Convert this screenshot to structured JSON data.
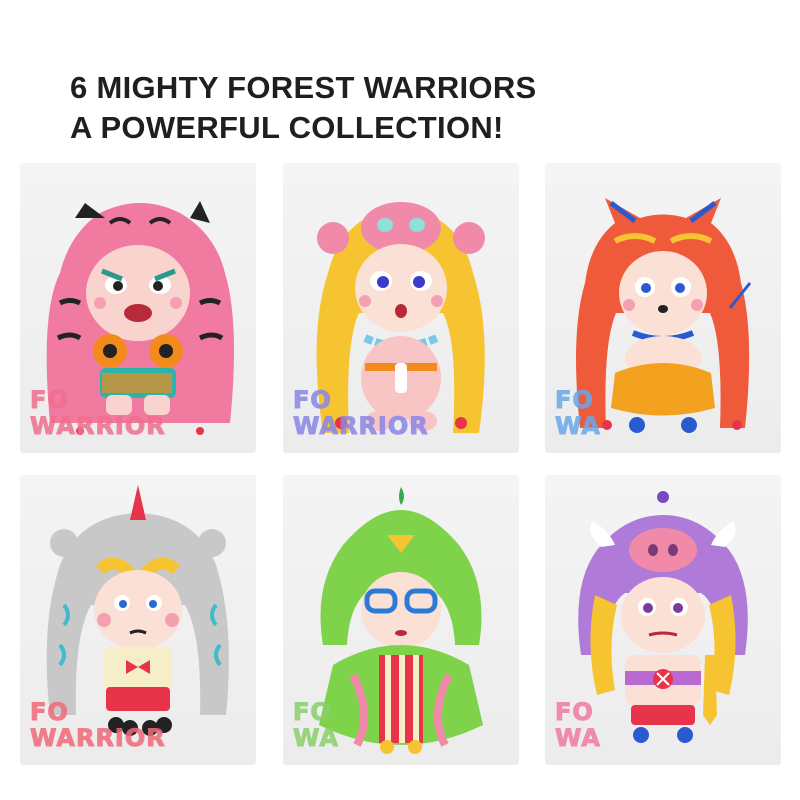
{
  "headline": {
    "line1": "6 MIGHTY FOREST WARRIORS",
    "line2": "A POWERFUL COLLECTION!"
  },
  "figures": [
    {
      "id": "tiger",
      "watermark_top": "FO",
      "watermark_bottom": "WARRIOR",
      "hood_color": "#f07aa0",
      "accent_color": "#f28a1e",
      "watermark_color": "#ef6f8e"
    },
    {
      "id": "monkey",
      "watermark_top": "FO",
      "watermark_bottom": "WARRIOR",
      "hood_color": "#f5c430",
      "accent_color": "#f08aa8",
      "watermark_color": "#8a86e8"
    },
    {
      "id": "fox",
      "watermark_top": "FO",
      "watermark_bottom": "WA",
      "hood_color": "#ef5a3a",
      "accent_color": "#f2a21e",
      "watermark_color": "#6aa8e8"
    },
    {
      "id": "rhino",
      "watermark_top": "FO",
      "watermark_bottom": "WARRIOR",
      "hood_color": "#c8c8c8",
      "accent_color": "#e8344a",
      "watermark_color": "#f06a78"
    },
    {
      "id": "parrot",
      "watermark_top": "FO",
      "watermark_bottom": "WA",
      "hood_color": "#7fd34a",
      "accent_color": "#3aa0e8",
      "watermark_color": "#8ad06a"
    },
    {
      "id": "boar",
      "watermark_top": "FO",
      "watermark_bottom": "WA",
      "hood_color": "#b07ad8",
      "accent_color": "#e8344a",
      "watermark_color": "#f07aa0"
    }
  ]
}
